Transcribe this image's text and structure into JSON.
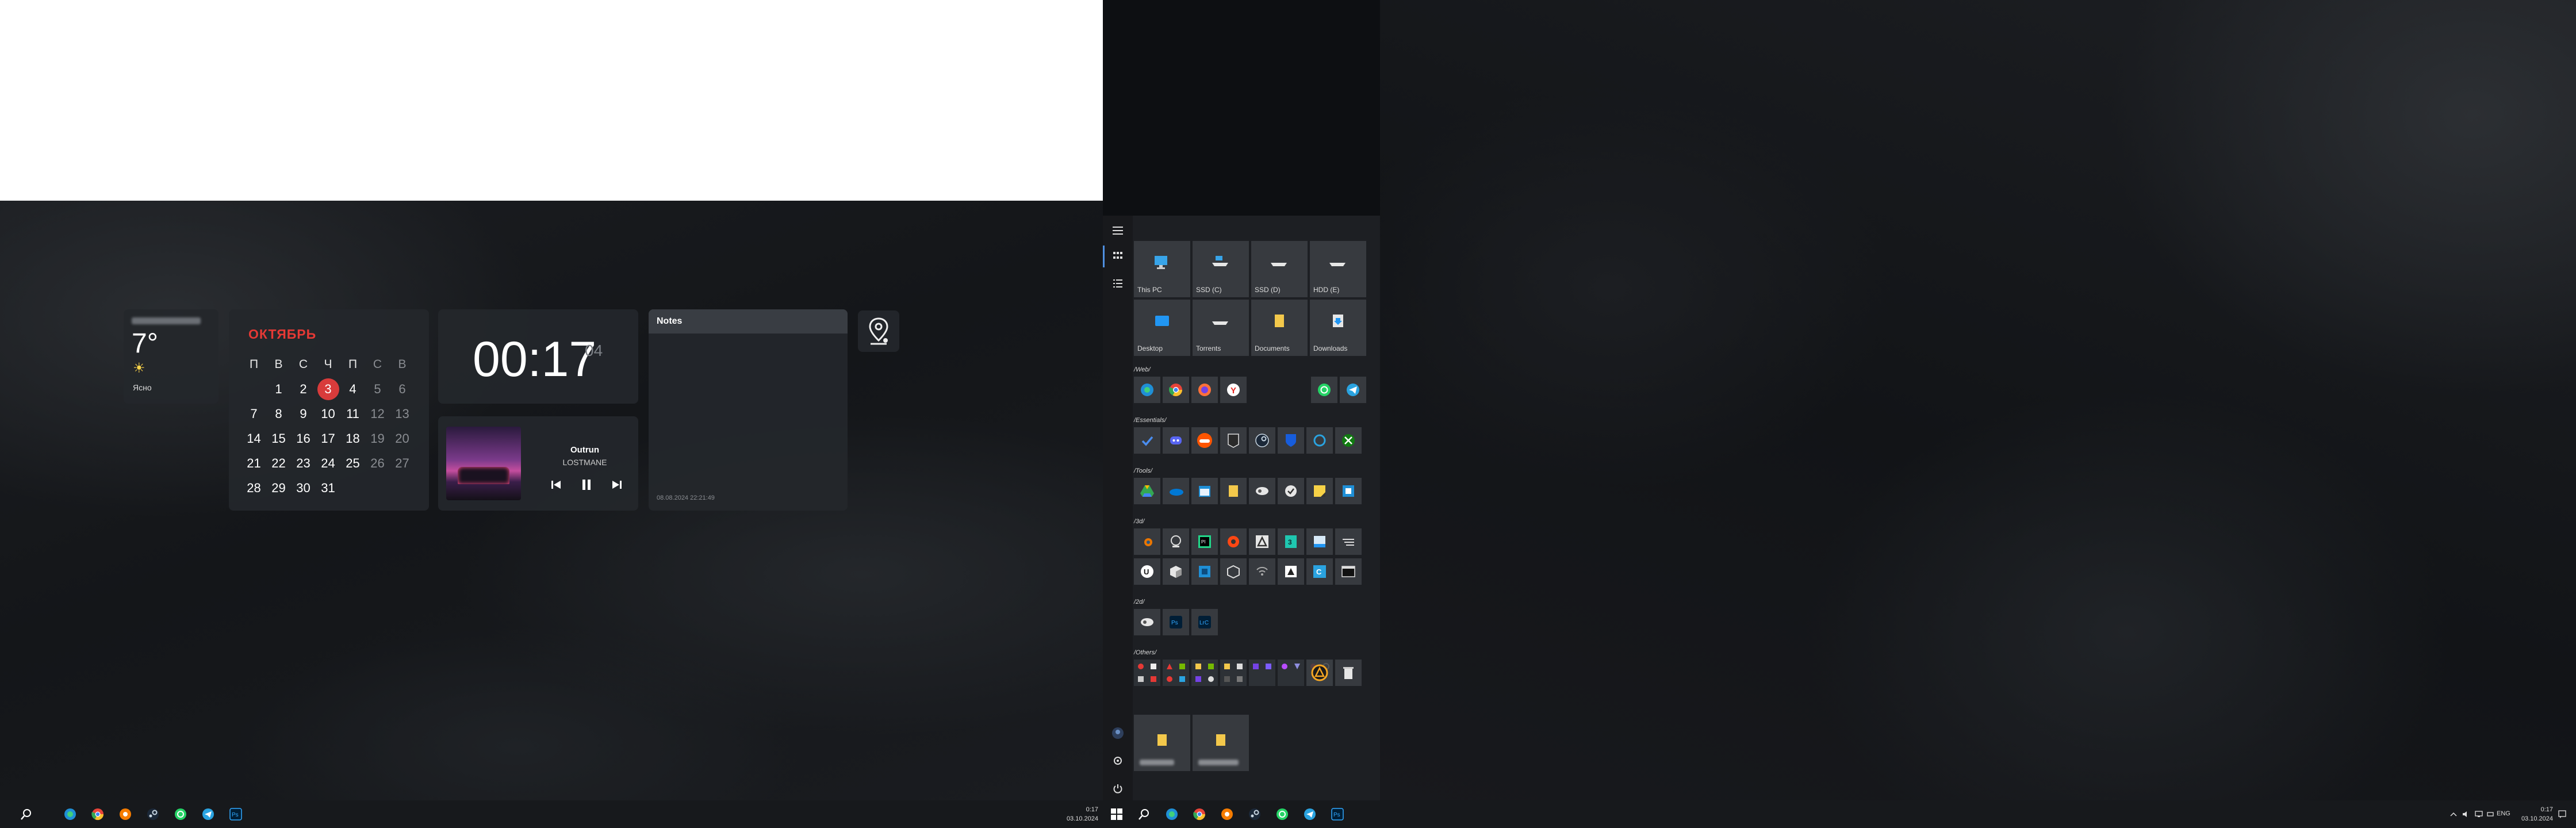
{
  "left_screen": {
    "weather": {
      "temperature": "7°",
      "condition": "Ясно",
      "icon": "sun-icon"
    },
    "calendar": {
      "month": "ОКТЯБРЬ",
      "weekdays": [
        "П",
        "В",
        "С",
        "Ч",
        "П",
        "С",
        "В"
      ],
      "weeks": [
        [
          "",
          "1",
          "2",
          "3",
          "4",
          "5",
          "6"
        ],
        [
          "7",
          "8",
          "9",
          "10",
          "11",
          "12",
          "13"
        ],
        [
          "14",
          "15",
          "16",
          "17",
          "18",
          "19",
          "20"
        ],
        [
          "21",
          "22",
          "23",
          "24",
          "25",
          "26",
          "27"
        ],
        [
          "28",
          "29",
          "30",
          "31",
          "",
          "",
          ""
        ]
      ],
      "today": "3"
    },
    "clock": {
      "time": "00:17",
      "seconds": "04"
    },
    "music": {
      "title": "Outrun",
      "artist": "LOSTMANE"
    },
    "notes": {
      "title": "Notes",
      "timestamp": "08.08.2024 22:21:49"
    },
    "taskbar": {
      "time": "0:17",
      "date": "03.10.2024"
    }
  },
  "start_menu": {
    "drives": [
      {
        "label": "This PC",
        "icon": "monitor-icon"
      },
      {
        "label": "SSD (C)",
        "icon": "drive-icon"
      },
      {
        "label": "SSD (D)",
        "icon": "drive-icon"
      },
      {
        "label": "HDD (E)",
        "icon": "drive-icon"
      },
      {
        "label": "Desktop",
        "icon": "desktop-folder-icon"
      },
      {
        "label": "Torrents",
        "icon": "drive-icon"
      },
      {
        "label": "Documents",
        "icon": "documents-folder-icon"
      },
      {
        "label": "Downloads",
        "icon": "downloads-folder-icon"
      }
    ],
    "groups": [
      {
        "label": "/Web/"
      },
      {
        "label": "/Essentials/"
      },
      {
        "label": "/Tools/"
      },
      {
        "label": "/3d/"
      },
      {
        "label": "/2d/"
      },
      {
        "label": "/Others/"
      }
    ]
  },
  "right_screen": {
    "taskbar": {
      "language": "ENG",
      "time": "0:17",
      "date": "03.10.2024"
    }
  },
  "colors": {
    "accent_red": "#d83b3b",
    "tile_bg": "#3c3f44",
    "taskbar_bg": "#17191c"
  }
}
